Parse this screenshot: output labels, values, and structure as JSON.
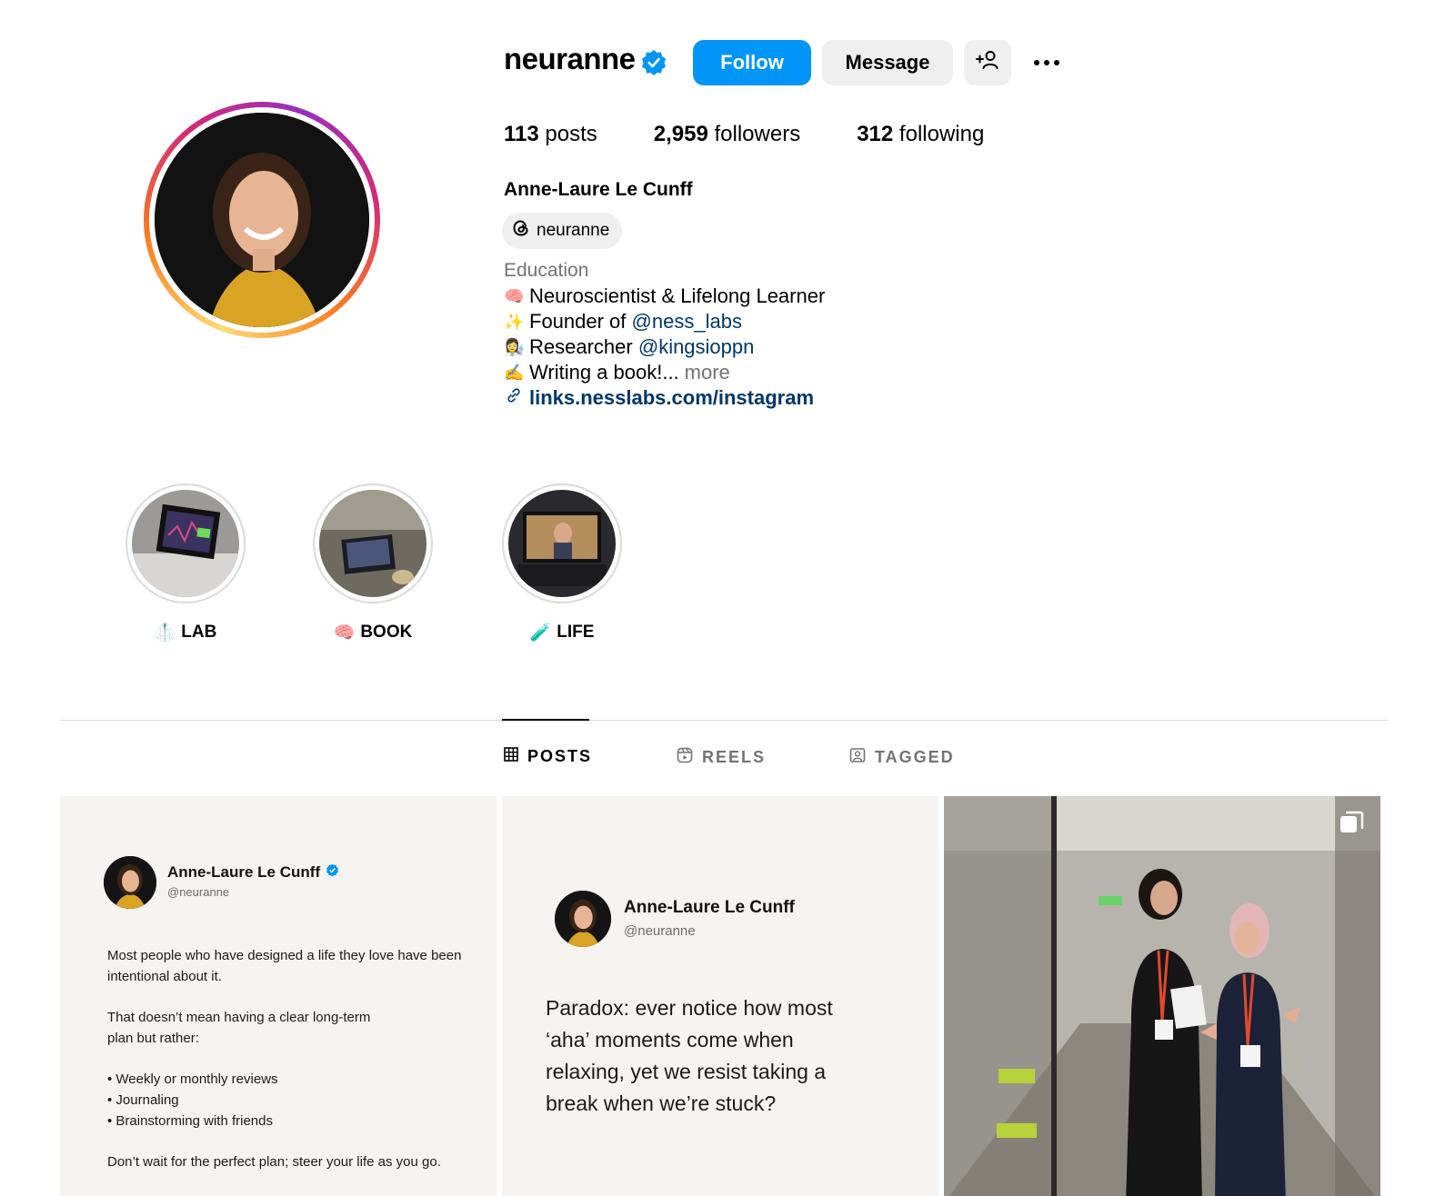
{
  "profile": {
    "username": "neuranne",
    "follow_label": "Follow",
    "message_label": "Message",
    "stats": {
      "posts_count": "113",
      "posts_label": "posts",
      "followers_count": "2,959",
      "followers_label": "followers",
      "following_count": "312",
      "following_label": "following"
    },
    "full_name": "Anne-Laure Le Cunff",
    "threads_handle": "neuranne",
    "category": "Education",
    "bio": {
      "line1": "Neuroscientist & Lifelong Learner",
      "line2_prefix": "Founder of ",
      "line2_mention": "ness_labs",
      "line3_prefix": "Researcher ",
      "line3_mention": "kingsioppn",
      "line4": "Writing a book!...",
      "more": "more",
      "link": "links.nesslabs.com/instagram"
    }
  },
  "highlights": [
    {
      "label": "LAB",
      "emoji": "🥼"
    },
    {
      "label": "BOOK",
      "emoji": "🧠"
    },
    {
      "label": "LIFE",
      "emoji": "🧪"
    }
  ],
  "tabs": {
    "posts": "POSTS",
    "reels": "REELS",
    "tagged": "TAGGED"
  },
  "posts": {
    "post1": {
      "name": "Anne-Laure Le Cunff",
      "handle": "@neuranne",
      "p1": "Most people who have designed a life they love have been intentional about it.",
      "p2": "That doesn’t mean having a clear long-term plan but rather:",
      "bullet1": "• Weekly or monthly reviews",
      "bullet2": "• Journaling",
      "bullet3": "• Brainstorming with friends",
      "p3": "Don’t wait for the perfect plan; steer your life as you go."
    },
    "post2": {
      "name": "Anne-Laure Le Cunff",
      "handle": "@neuranne",
      "text": "Paradox: ever notice how most ‘aha’ moments come when relaxing, yet we resist taking a break when we’re stuck?"
    }
  },
  "colors": {
    "follow_button": "#0095f6",
    "verified_badge": "#0095f6",
    "link": "#00376b",
    "muted_text": "#737373"
  },
  "icons": [
    "verified-badge-icon",
    "add-user-icon",
    "more-options-icon",
    "threads-icon",
    "link-icon",
    "grid-icon",
    "reels-icon",
    "tagged-icon",
    "carousel-icon"
  ]
}
